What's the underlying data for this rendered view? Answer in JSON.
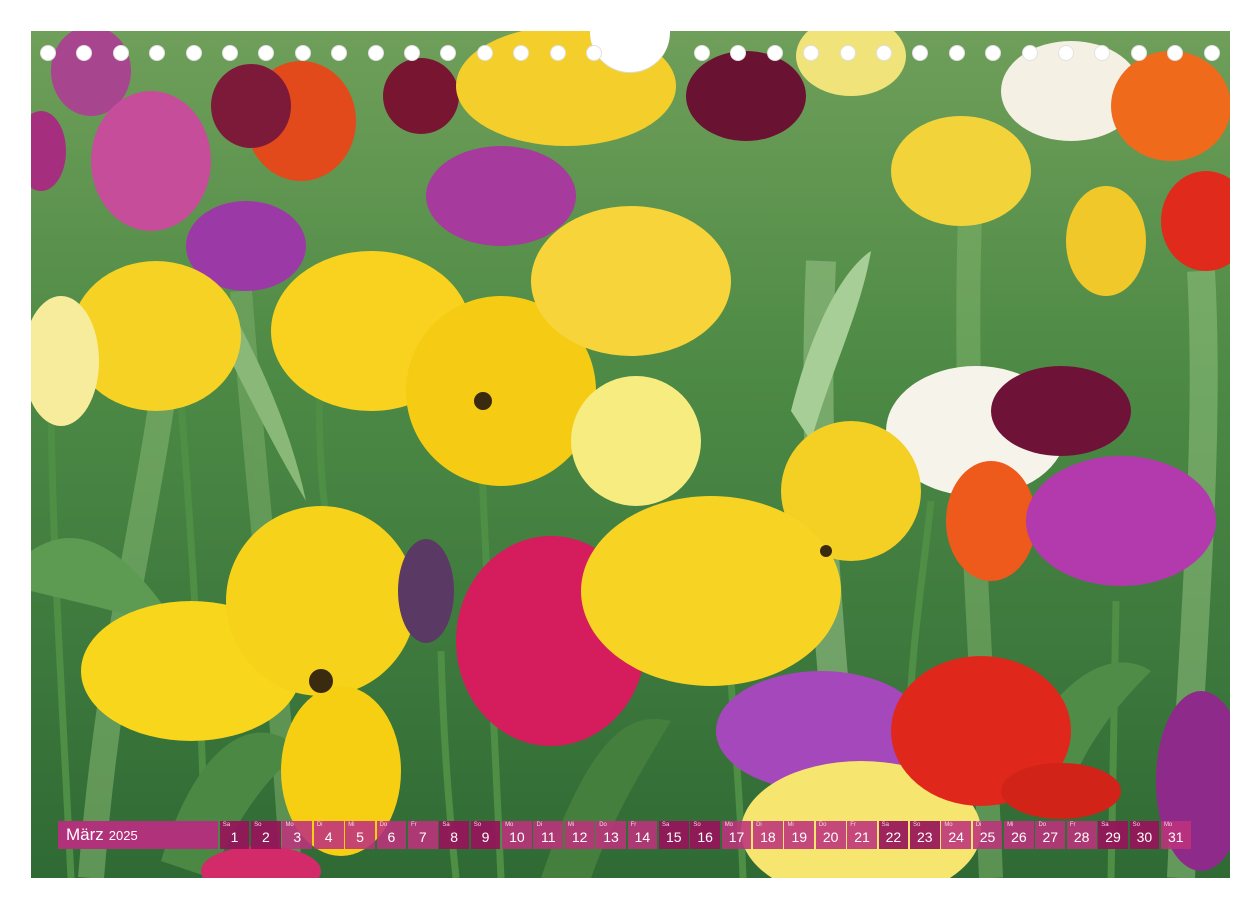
{
  "calendar": {
    "month": "März",
    "year": "2025",
    "days": [
      {
        "n": "1",
        "wd": "Sa",
        "we": true
      },
      {
        "n": "2",
        "wd": "So",
        "we": true
      },
      {
        "n": "3",
        "wd": "Mo",
        "we": false
      },
      {
        "n": "4",
        "wd": "Di",
        "we": false
      },
      {
        "n": "5",
        "wd": "Mi",
        "we": false
      },
      {
        "n": "6",
        "wd": "Do",
        "we": false
      },
      {
        "n": "7",
        "wd": "Fr",
        "we": false
      },
      {
        "n": "8",
        "wd": "Sa",
        "we": true
      },
      {
        "n": "9",
        "wd": "So",
        "we": true
      },
      {
        "n": "10",
        "wd": "Mo",
        "we": false
      },
      {
        "n": "11",
        "wd": "Di",
        "we": false
      },
      {
        "n": "12",
        "wd": "Mi",
        "we": false
      },
      {
        "n": "13",
        "wd": "Do",
        "we": false
      },
      {
        "n": "14",
        "wd": "Fr",
        "we": false
      },
      {
        "n": "15",
        "wd": "Sa",
        "we": true
      },
      {
        "n": "16",
        "wd": "So",
        "we": true
      },
      {
        "n": "17",
        "wd": "Mo",
        "we": false
      },
      {
        "n": "18",
        "wd": "Di",
        "we": false
      },
      {
        "n": "19",
        "wd": "Mi",
        "we": false
      },
      {
        "n": "20",
        "wd": "Do",
        "we": false
      },
      {
        "n": "21",
        "wd": "Fr",
        "we": false
      },
      {
        "n": "22",
        "wd": "Sa",
        "we": true
      },
      {
        "n": "23",
        "wd": "So",
        "we": true
      },
      {
        "n": "24",
        "wd": "Mo",
        "we": false
      },
      {
        "n": "25",
        "wd": "Di",
        "we": false
      },
      {
        "n": "26",
        "wd": "Mi",
        "we": false
      },
      {
        "n": "27",
        "wd": "Do",
        "we": false
      },
      {
        "n": "28",
        "wd": "Fr",
        "we": false
      },
      {
        "n": "29",
        "wd": "Sa",
        "we": true
      },
      {
        "n": "30",
        "wd": "So",
        "we": true
      },
      {
        "n": "31",
        "wd": "Mo",
        "we": false
      }
    ]
  },
  "colors": {
    "month_bar": "#b0327a",
    "tulip_yellow": "#f6d21c",
    "tulip_magenta": "#d61f63",
    "tulip_purple": "#b63fb0",
    "tulip_red": "#e0261b",
    "tulip_orange": "#ec5a1c",
    "tulip_white": "#f4f2e6"
  }
}
